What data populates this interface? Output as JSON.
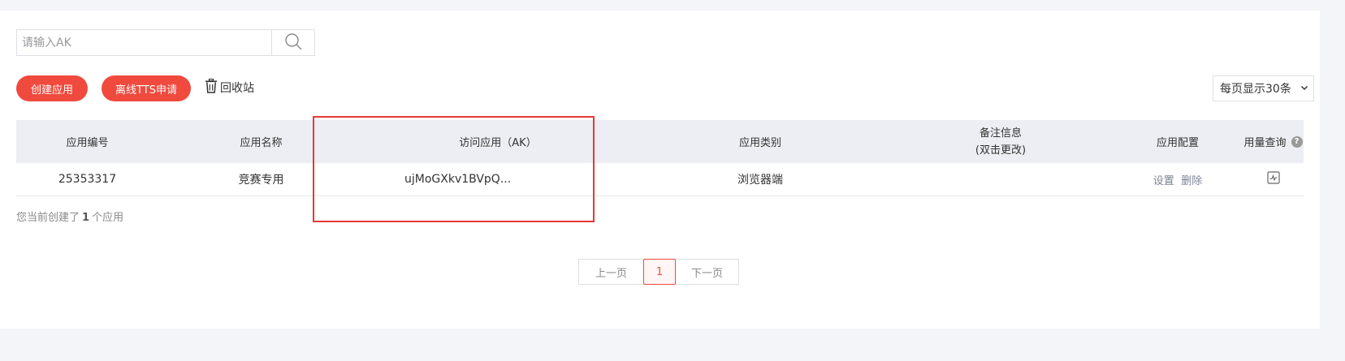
{
  "search": {
    "placeholder": "请输入AK",
    "value": "",
    "icon": "search-icon"
  },
  "toolbar": {
    "create_label": "创建应用",
    "tts_label": "离线TTS申请",
    "recycle_label": "回收站",
    "recycle_icon": "trash-icon",
    "page_size_label": "每页显示30条"
  },
  "table": {
    "headers": {
      "id": "应用编号",
      "name": "应用名称",
      "ak": "访问应用（AK）",
      "type": "应用类别",
      "remark_line1": "备注信息",
      "remark_line2": "(双击更改)",
      "config": "应用配置",
      "usage": "用量查询"
    },
    "rows": [
      {
        "id": "25353317",
        "name": "竞赛专用",
        "ak": "ujMoGXkv1BVpQ...",
        "type": "浏览器端",
        "remark": "",
        "config_set": "设置",
        "config_delete": "删除",
        "usage_icon": "chart-icon"
      }
    ]
  },
  "summary": {
    "prefix": "您当前创建了",
    "count": "1",
    "suffix": "个应用"
  },
  "pagination": {
    "prev": "上一页",
    "current": "1",
    "next": "下一页"
  },
  "colors": {
    "accent": "#f04a3e",
    "highlight": "#e53935",
    "header_bg": "#eceef3"
  }
}
